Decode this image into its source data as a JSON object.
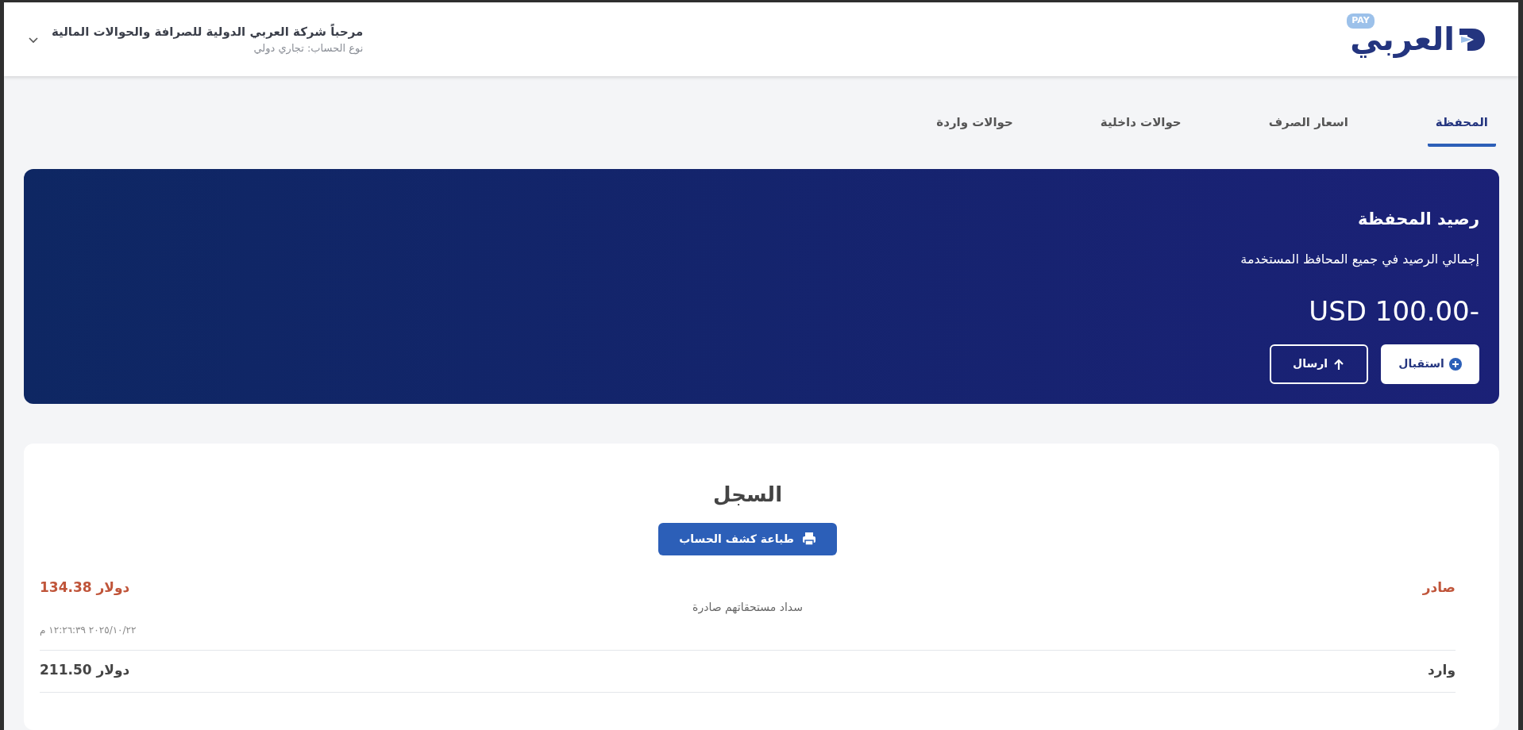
{
  "header": {
    "greeting": "مرحباً شركة العربي الدولية للصرافة والحوالات المالية",
    "account_type": "نوع الحساب: تجاري دولي",
    "logo": {
      "name": "العربي",
      "badge": "PAY"
    }
  },
  "tabs": [
    {
      "label": "المحفظة",
      "selected": true
    },
    {
      "label": "اسعار الصرف",
      "selected": false
    },
    {
      "label": "حوالات داخلية",
      "selected": false
    },
    {
      "label": "حوالات واردة",
      "selected": false
    }
  ],
  "wallet": {
    "title": "رصيد المحفظة",
    "subtitle": "إجمالي الرصيد في جميع المحافظ المستخدمة",
    "balance": "USD 100.00-",
    "buttons": [
      {
        "label": "استقبال",
        "kind": "receive"
      },
      {
        "label": "ارسال",
        "kind": "send"
      }
    ]
  },
  "log": {
    "title": "السجل",
    "print_button": "طباعة كشف الحساب",
    "entries": [
      {
        "kind": "outgoing",
        "direction": "صادر",
        "amount": "134.38 دولار",
        "description": "سداد مستحقاتهم صادرة",
        "date": "٢٠٢٥/١٠/٢٢ ١٢:٢٦:٣٩ م"
      },
      {
        "kind": "incoming",
        "direction": "وارد",
        "amount": "211.50 دولار"
      }
    ]
  }
}
